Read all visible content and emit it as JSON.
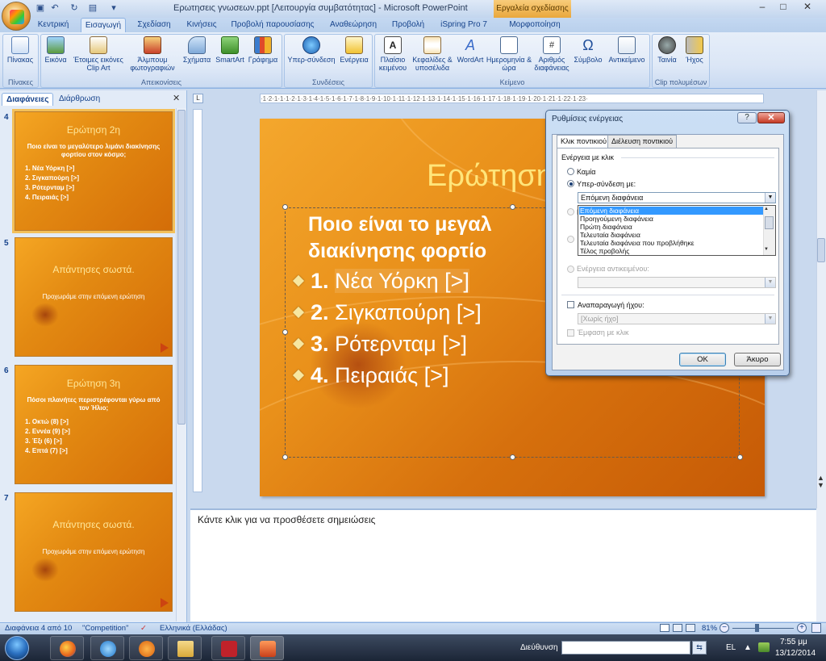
{
  "window": {
    "title": "Ερωτησεις γνωσεων.ppt [Λειτουργία συμβατότητας] - Microsoft PowerPoint",
    "context_tab": "Εργαλεία σχεδίασης",
    "min": "–",
    "max": "□",
    "close": "✕"
  },
  "ribbon_tabs": [
    "Κεντρική",
    "Εισαγωγή",
    "Σχεδίαση",
    "Κινήσεις",
    "Προβολή παρουσίασης",
    "Αναθεώρηση",
    "Προβολή",
    "iSpring Pro 7",
    "Μορφοποίηση"
  ],
  "ribbon": {
    "groups": [
      "Πίνακες",
      "Απεικονίσεις",
      "Συνδέσεις",
      "Κείμενο",
      "Clip πολυμέσων"
    ],
    "buttons": [
      "Πίνακας",
      "Εικόνα",
      "Έτοιμες εικόνες Clip Art",
      "Άλμπουμ φωτογραφιών",
      "Σχήματα",
      "SmartArt",
      "Γράφημα",
      "Υπερ-σύνδεση",
      "Ενέργεια",
      "Πλαίσιο κειμένου",
      "Κεφαλίδες & υποσέλιδα",
      "WordArt",
      "Ημερομηνία & ώρα",
      "Αριθμός διαφάνειας",
      "Σύμβολο",
      "Αντικείμενο",
      "Ταινία",
      "Ήχος"
    ]
  },
  "pane_tabs": [
    "Διαφάνειες",
    "Διάρθρωση"
  ],
  "thumbs": [
    {
      "num": "4",
      "title": "Ερώτηση 2η",
      "question": "Ποιο είναι το μεγαλύτερο λιμάνι διακίνησης φορτίου στον κόσμο;",
      "items": [
        "1. Νέα Υόρκη [>]",
        "2. Σιγκαπούρη [>]",
        "3. Ρότερνταμ [>]",
        "4. Πειραιάς [>]"
      ]
    },
    {
      "num": "5",
      "title": "Απάντησες σωστά.",
      "sub": "Προχωράμε στην επόμενη ερώτηση"
    },
    {
      "num": "6",
      "title": "Ερώτηση 3η",
      "question": "Πόσοι πλανήτες περιστρέφονται γύρω από τον Ήλιο;",
      "items": [
        "1. Οκτώ (8) [>]",
        "2. Εννέα (9) [>]",
        "3. Έξι (6) [>]",
        "4. Επτά (7) [>]"
      ]
    },
    {
      "num": "7",
      "title": "Απάντησες σωστά.",
      "sub": "Προχωράμε στην επόμενη ερώτηση"
    }
  ],
  "ruler_text": "·1·2·1·1·1·2·1·3·1·4·1·5·1·6·1·7·1·8·1·9·1·10·1·11·1·12·1·13·1·14·1·15·1·16·1·17·1·18·1·19·1·20·1·21·1·22·1·23·",
  "ruler_corner": "L",
  "slide": {
    "title": "Ερώτηση",
    "question_line1": "Ποιο είναι το μεγαλ",
    "question_line2": "διακίνησης φορτίο",
    "answers": [
      {
        "num": "1.",
        "text": "Νέα Υόρκη [>]"
      },
      {
        "num": "2.",
        "text": "Σιγκαπούρη [>]"
      },
      {
        "num": "3.",
        "text": "Ρότερνταμ [>]"
      },
      {
        "num": "4.",
        "text": "Πειραιάς [>]"
      }
    ]
  },
  "notes_placeholder": "Κάντε κλικ για να προσθέσετε σημειώσεις",
  "dialog": {
    "title": "Ρυθμίσεις ενέργειας",
    "help": "?",
    "close": "✕",
    "tabs": [
      "Κλικ ποντικιού",
      "Διέλευση ποντικιού"
    ],
    "section": "Ενέργεια με κλικ",
    "opt_none": "Καμία",
    "opt_hyperlink": "Υπερ-σύνδεση με:",
    "hyperlink_value": "Επόμενη διαφάνεια",
    "dropdown_options": [
      "Επόμενη διαφάνεια",
      "Προηγούμενη διαφάνεια",
      "Πρώτη διαφάνεια",
      "Τελευταία διαφάνεια",
      "Τελευταία διαφάνεια που προβλήθηκε",
      "Τέλος προβολής"
    ],
    "hidden_opt1": "Ε",
    "opt_object": "Ενέργεια αντικειμένου:",
    "play_sound": "Αναπαραγωγή ήχου:",
    "sound_value": "[Χωρίς ήχο]",
    "highlight": "Έμφαση με κλικ",
    "ok": "ΟΚ",
    "cancel": "Άκυρο"
  },
  "status": {
    "slide_of": "Διαφάνεια 4 από 10",
    "theme": "\"Competition\"",
    "language": "Ελληνικά (Ελλάδας)",
    "zoom": "81%"
  },
  "taskbar": {
    "address_label": "Διεύθυνση",
    "lang": "EL",
    "time": "7:55 μμ",
    "date": "13/12/2014"
  }
}
